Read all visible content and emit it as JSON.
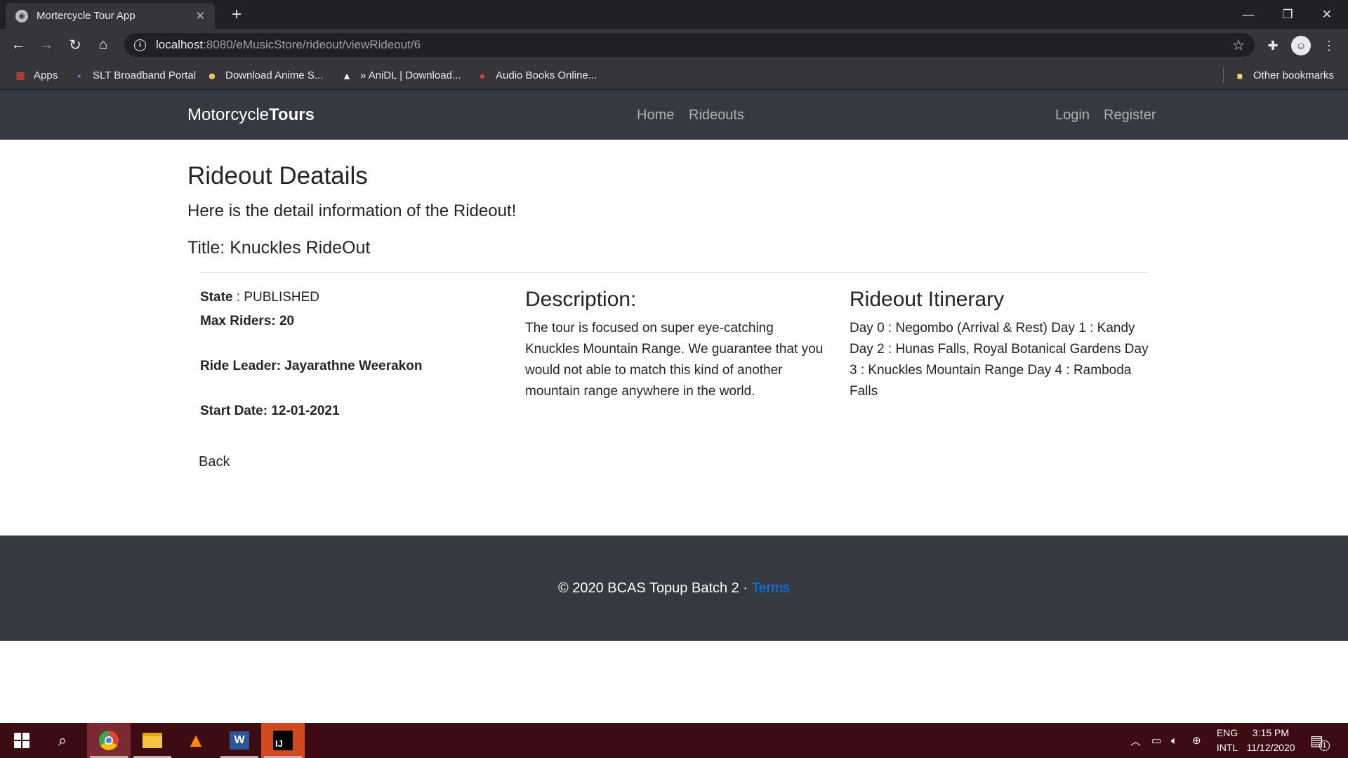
{
  "browser": {
    "tab_title": "Mortercycle Tour App",
    "tab_close": "✕",
    "new_tab": "+",
    "url_host": "localhost",
    "url_path": ":8080/eMusicStore/rideout/viewRideout/6",
    "bookmarks": [
      {
        "label": "Apps",
        "icon": "apps-grid-icon"
      },
      {
        "label": "SLT Broadband Portal",
        "icon": "slt-icon"
      },
      {
        "label": "Download Anime S...",
        "icon": "anime-icon"
      },
      {
        "label": "» AniDL | Download...",
        "icon": "anidl-icon"
      },
      {
        "label": "Audio Books Online...",
        "icon": "audiobooks-icon"
      }
    ],
    "other_bookmarks": "Other bookmarks"
  },
  "navbar": {
    "brand_light": "Motorcycle",
    "brand_bold": "Tours",
    "links": [
      "Home",
      "Rideouts"
    ],
    "auth": [
      "Login",
      "Register"
    ]
  },
  "main": {
    "page_title": "Rideout Deatails",
    "lead": "Here is the detail information of the Rideout!",
    "ride_title": "Title: Knuckles RideOut",
    "state_label": "State",
    "state_value": " : PUBLISHED",
    "max_riders": "Max Riders: 20",
    "ride_leader": "Ride Leader: Jayarathne Weerakon",
    "start_date": "Start Date: 12-01-2021",
    "description_heading": "Description:",
    "description_text": "The tour is focused on super eye-catching Knuckles Mountain Range. We guarantee that you would not able to match this kind of another mountain range anywhere in the world.",
    "itinerary_heading": "Rideout Itinerary",
    "itinerary_text": "Day 0 : Negombo (Arrival & Rest) Day 1 : Kandy Day 2 : Hunas Falls, Royal Botanical Gardens Day 3 : Knuckles Mountain Range Day 4 : Ramboda Falls",
    "back_label": "Back"
  },
  "footer": {
    "copyright": "© 2020 BCAS Topup Batch 2 · ",
    "terms": "Terms"
  },
  "taskbar": {
    "lang_top": "ENG",
    "lang_bottom": "INTL",
    "time": "3:15 PM",
    "date": "11/12/2020",
    "notification_count": "1"
  },
  "colors": {
    "navbar_bg": "#343a40",
    "link_accent": "#007bff",
    "taskbar_bg": "#3d0c12"
  }
}
